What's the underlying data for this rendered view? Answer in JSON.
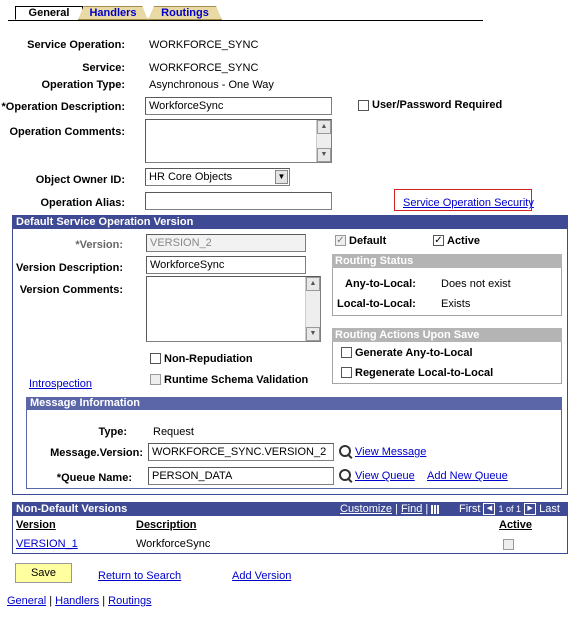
{
  "tabs": [
    "General",
    "Handlers",
    "Routings"
  ],
  "header": {
    "service_operation_label": "Service Operation:",
    "service_operation_value": "WORKFORCE_SYNC",
    "service_label": "Service:",
    "service_value": "WORKFORCE_SYNC",
    "operation_type_label": "Operation Type:",
    "operation_type_value": "Asynchronous - One Way",
    "operation_description_label": "*Operation Description:",
    "operation_description_value": "WorkforceSync",
    "user_password_label": "User/Password Required",
    "operation_comments_label": "Operation Comments:",
    "object_owner_label": "Object Owner ID:",
    "object_owner_value": "HR Core Objects",
    "operation_alias_label": "Operation Alias:",
    "operation_alias_value": "",
    "security_link": "Service Operation Security"
  },
  "version": {
    "section_title": "Default Service Operation Version",
    "version_label": "*Version:",
    "version_value": "VERSION_2",
    "default_label": "Default",
    "active_label": "Active",
    "version_desc_label": "Version Description:",
    "version_desc_value": "WorkforceSync",
    "version_comments_label": "Version Comments:",
    "routing_status_title": "Routing Status",
    "any_to_local_label": "Any-to-Local:",
    "any_to_local_value": "Does not exist",
    "local_to_local_label": "Local-to-Local:",
    "local_to_local_value": "Exists",
    "routing_actions_title": "Routing Actions Upon Save",
    "generate_label": "Generate Any-to-Local",
    "regenerate_label": "Regenerate Local-to-Local",
    "non_repudiation_label": "Non-Repudiation",
    "runtime_schema_label": "Runtime Schema Validation",
    "introspection_link": "Introspection"
  },
  "message": {
    "section_title": "Message Information",
    "type_label": "Type:",
    "type_value": "Request",
    "message_version_label": "Message.Version:",
    "message_version_value": "WORKFORCE_SYNC.VERSION_2",
    "view_message_link": "View Message",
    "queue_name_label": "*Queue Name:",
    "queue_name_value": "PERSON_DATA",
    "view_queue_link": "View Queue",
    "add_new_queue_link": "Add New Queue"
  },
  "non_default": {
    "title": "Non-Default Versions",
    "customize_link": "Customize",
    "find_link": "Find",
    "separator": "|",
    "first_label": "First",
    "range_text": "1 of 1",
    "last_label": "Last",
    "columns": [
      "Version",
      "Description",
      "Active"
    ],
    "rows": [
      {
        "version": "VERSION_1",
        "description": "WorkforceSync"
      }
    ]
  },
  "footer": {
    "save_button": "Save",
    "return_link": "Return to Search",
    "add_version_link": "Add Version",
    "bottom_links": [
      "General",
      "Handlers",
      "Routings"
    ],
    "bottom_separator": "|"
  },
  "colors": {
    "band": "#3e4a93",
    "group_header": "#b4b4b4",
    "link": "#0000cc",
    "save_button": "#ffffa0",
    "highlight_border": "#d32020"
  },
  "icons": {
    "lookup": "magnifier-icon",
    "dropdown": "chevron-down-icon",
    "grid": "grid-icon"
  }
}
